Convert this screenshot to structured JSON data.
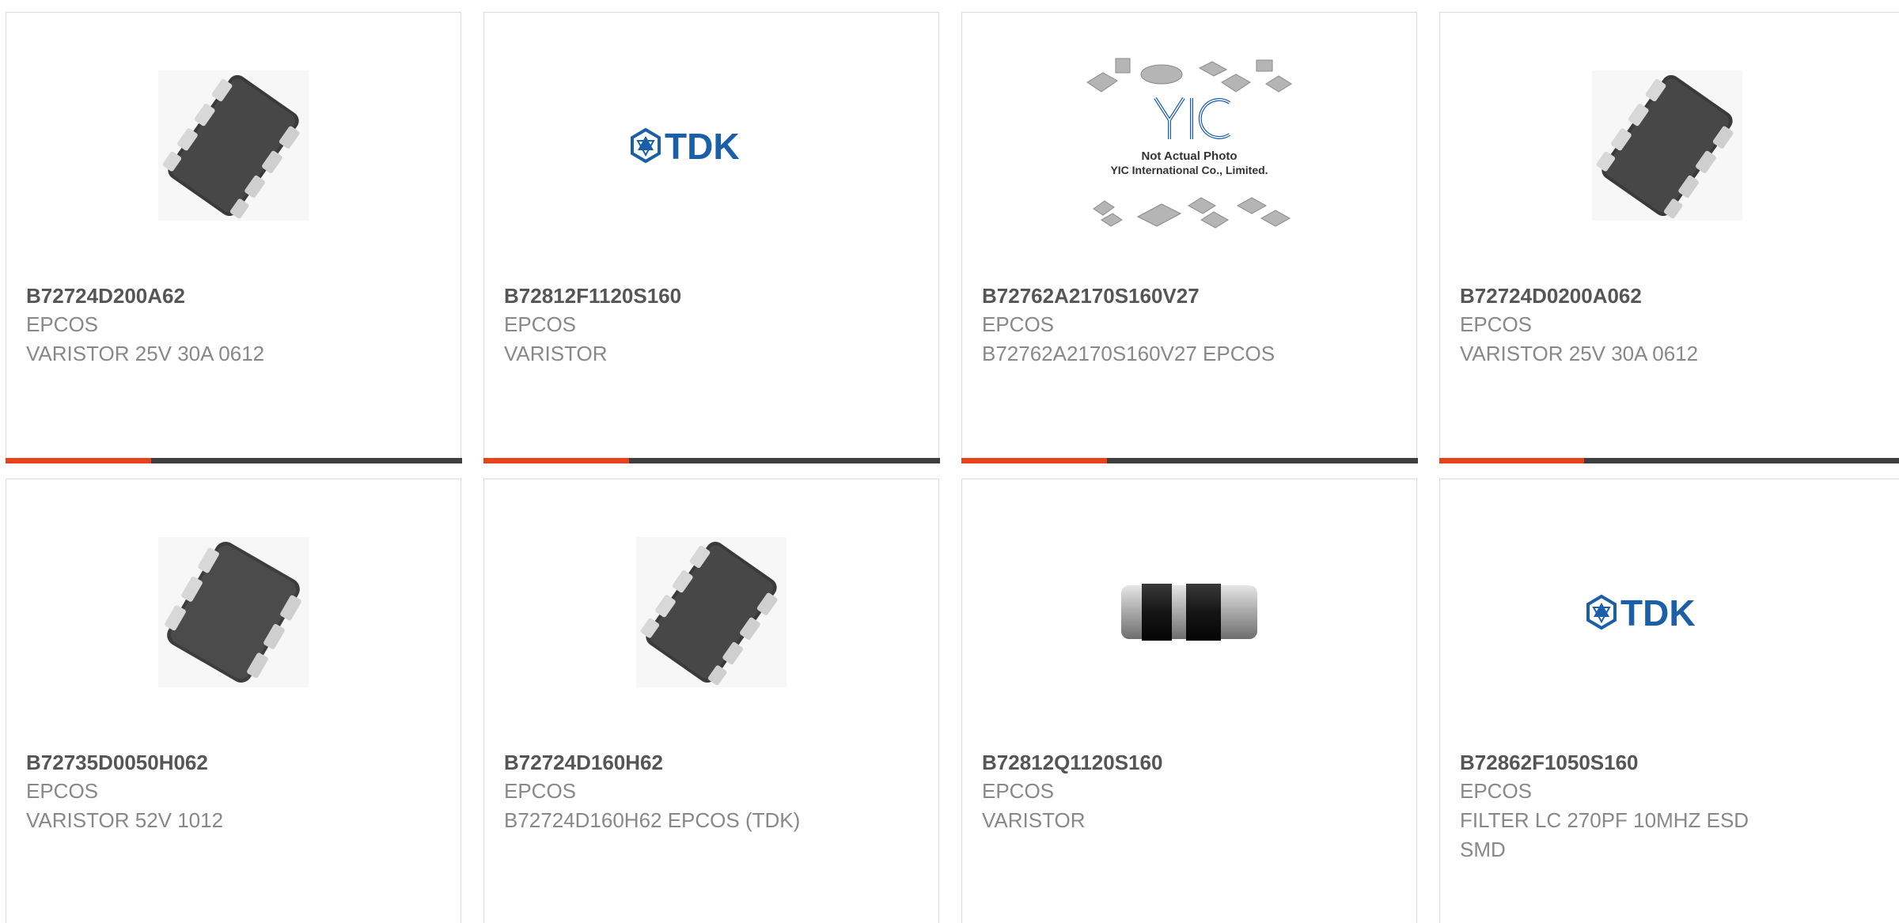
{
  "accent_color": "#e8431c",
  "bar_track_color": "#3f3f3f",
  "products": [
    {
      "part_number": "B72724D200A62",
      "manufacturer": "EPCOS",
      "description": "VARISTOR 25V 30A 0612",
      "image_icon": "varistor-array-chip-icon",
      "progress": 0.32
    },
    {
      "part_number": "B72812F1120S160",
      "manufacturer": "EPCOS",
      "description": "VARISTOR",
      "image_icon": "tdk-logo-icon",
      "image_logo_text": "TDK",
      "progress": 0.32
    },
    {
      "part_number": "B72762A2170S160V27",
      "manufacturer": "EPCOS",
      "description": "B72762A2170S160V27 EPCOS",
      "image_icon": "not-actual-photo-icon",
      "image_logo_text": "YIC",
      "image_caption_line1": "Not Actual Photo",
      "image_caption_line2": "YIC International Co., Limited.",
      "progress": 0.32
    },
    {
      "part_number": "B72724D0200A062",
      "manufacturer": "EPCOS",
      "description": "VARISTOR 25V 30A 0612",
      "image_icon": "varistor-array-chip-icon",
      "progress": 0.32
    },
    {
      "part_number": "B72735D0050H062",
      "manufacturer": "EPCOS",
      "description": "VARISTOR 52V 1012",
      "image_icon": "varistor-array-chip-icon",
      "progress": null
    },
    {
      "part_number": "B72724D160H62",
      "manufacturer": "EPCOS",
      "description": "B72724D160H62 EPCOS (TDK)",
      "image_icon": "varistor-array-chip-icon",
      "progress": null
    },
    {
      "part_number": "B72812Q1120S160",
      "manufacturer": "EPCOS",
      "description": "VARISTOR",
      "image_icon": "smd-chip-component-icon",
      "progress": null
    },
    {
      "part_number": "B72862F1050S160",
      "manufacturer": "EPCOS",
      "description": "FILTER LC 270PF 10MHZ ESD SMD",
      "image_icon": "tdk-logo-icon",
      "image_logo_text": "TDK",
      "progress": null
    }
  ]
}
